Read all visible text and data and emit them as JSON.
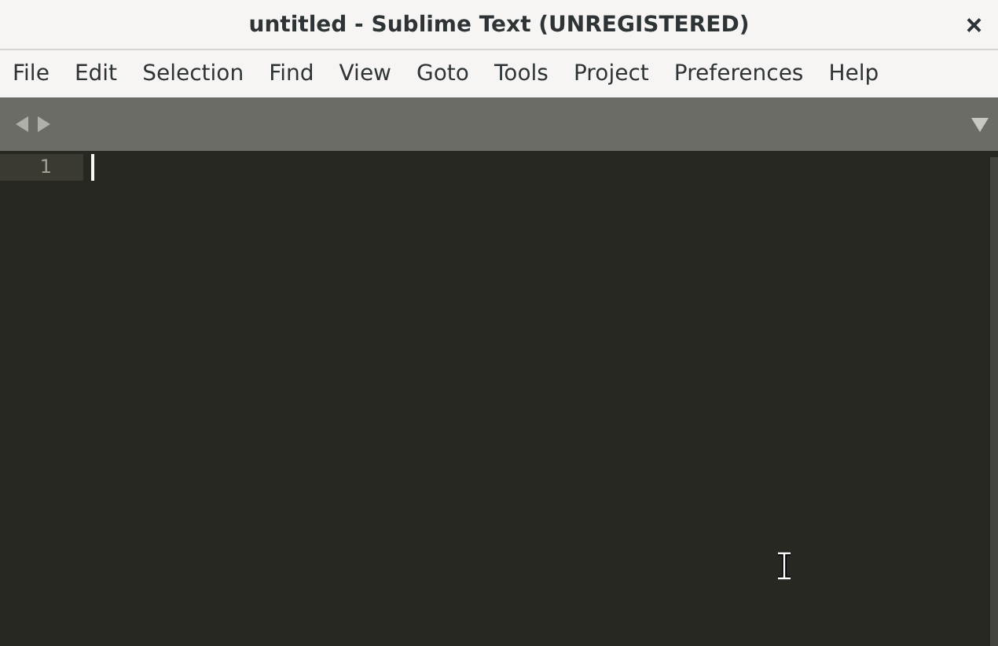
{
  "window": {
    "title": "untitled - Sublime Text (UNREGISTERED)",
    "close": "×"
  },
  "menu": [
    "File",
    "Edit",
    "Selection",
    "Find",
    "View",
    "Goto",
    "Tools",
    "Project",
    "Preferences",
    "Help"
  ],
  "editor": {
    "lines": [
      {
        "number": "1",
        "current": true
      }
    ]
  }
}
